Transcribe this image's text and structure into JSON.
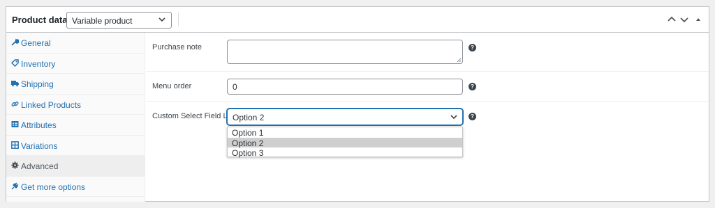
{
  "header": {
    "title": "Product data —",
    "product_type": "Variable product",
    "icons": [
      "chevron-up-icon",
      "chevron-down-icon",
      "triangle-up-icon"
    ]
  },
  "tabs": [
    {
      "label": "General",
      "icon": "wrench-icon"
    },
    {
      "label": "Inventory",
      "icon": "tag-icon"
    },
    {
      "label": "Shipping",
      "icon": "truck-icon"
    },
    {
      "label": "Linked Products",
      "icon": "link-icon"
    },
    {
      "label": "Attributes",
      "icon": "table-icon"
    },
    {
      "label": "Variations",
      "icon": "grid-icon"
    },
    {
      "label": "Advanced",
      "icon": "gear-icon",
      "active": true
    },
    {
      "label": "Get more options",
      "icon": "plugin-icon"
    }
  ],
  "fields": {
    "purchase_note": {
      "label": "Purchase note",
      "value": ""
    },
    "menu_order": {
      "label": "Menu order",
      "value": "0"
    },
    "custom_select": {
      "label": "Custom Select Field Label",
      "value": "Option 2"
    }
  },
  "dropdown": {
    "options": [
      "Option 1",
      "Option 2",
      "Option 3"
    ],
    "selected": "Option 2"
  },
  "colors": {
    "link": "#2271b1",
    "border": "#c3c4c7",
    "focus": "#2271b1"
  }
}
